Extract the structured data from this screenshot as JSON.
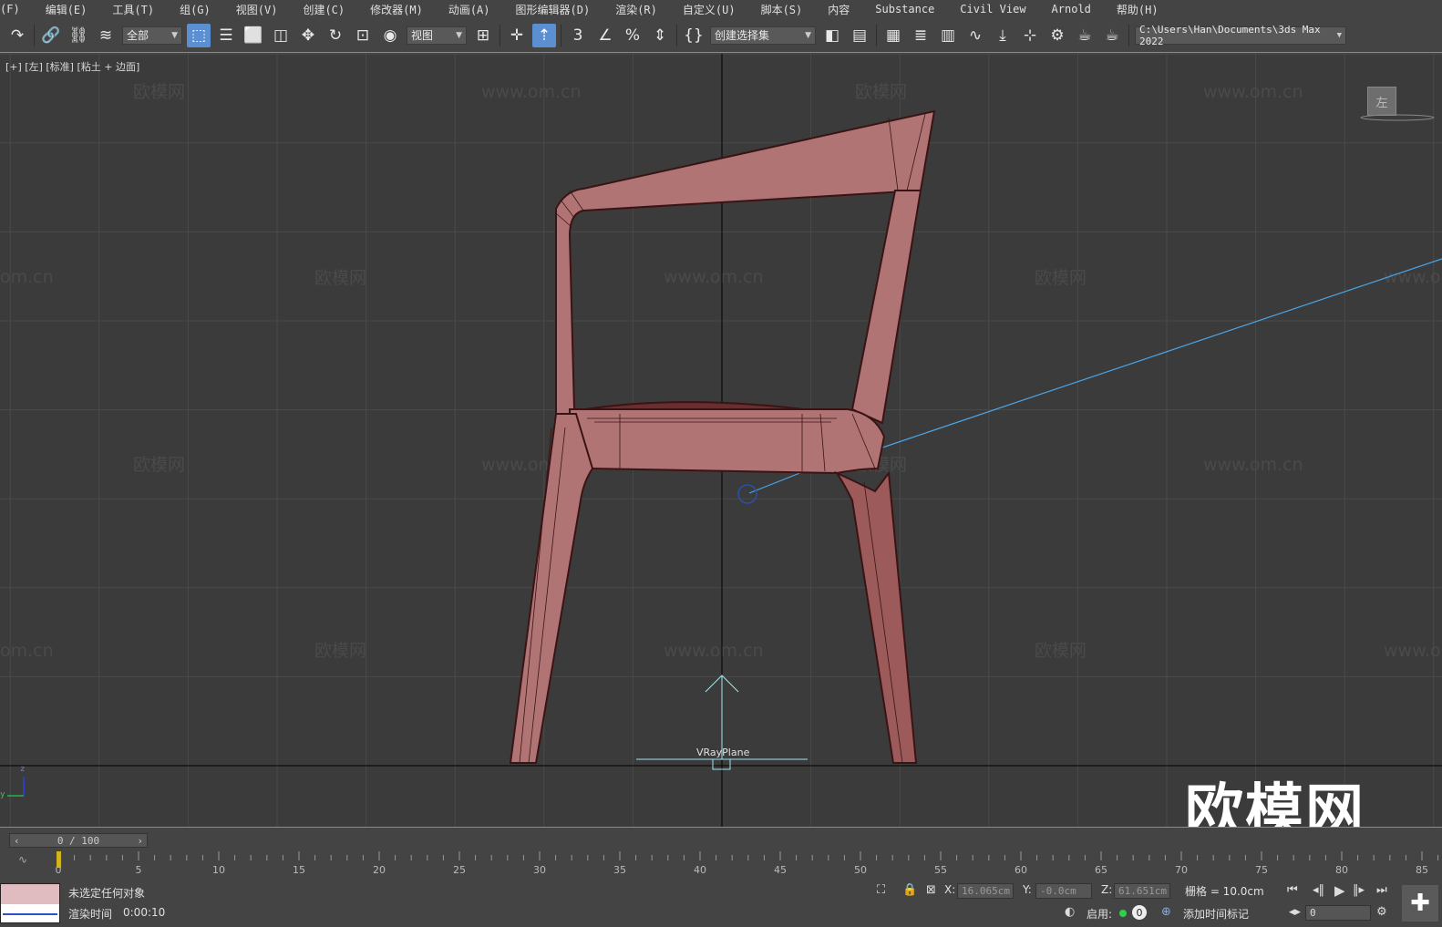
{
  "menu": [
    "(F)",
    "编辑(E)",
    "工具(T)",
    "组(G)",
    "视图(V)",
    "创建(C)",
    "修改器(M)",
    "动画(A)",
    "图形编辑器(D)",
    "渲染(R)",
    "自定义(U)",
    "脚本(S)",
    "内容",
    "Substance",
    "Civil View",
    "Arnold",
    "帮助(H)"
  ],
  "toolbar": {
    "selection_filter": "全部",
    "reference_coord": "视图",
    "named_selection": "创建选择集",
    "project_path": "C:\\Users\\Han\\Documents\\3ds Max 2022",
    "snap_label": "3"
  },
  "viewport": {
    "label": "[+] [左] [标准] [粘土 + 边面]",
    "object_label": "VRayPlane",
    "viewcube_face": "左",
    "watermark_big": "欧模网",
    "watermark_cn": "欧模网",
    "watermark_url": "www.om.cn",
    "watermark_partial": "om.cn",
    "watermark_partial2": "www.o",
    "axis_z": "z",
    "axis_y": "y"
  },
  "timeline": {
    "frame_display": "0 / 100",
    "ticks": [
      "0",
      "5",
      "10",
      "15",
      "20",
      "25",
      "30",
      "35",
      "40",
      "45",
      "50",
      "55",
      "60",
      "65",
      "70",
      "75",
      "80",
      "85"
    ]
  },
  "status": {
    "selection": "未选定任何对象",
    "render_time_label": "渲染时间",
    "render_time": "0:00:10",
    "x_label": "X:",
    "x_value": "16.065cm",
    "y_label": "Y:",
    "y_value": "-0.0cm",
    "z_label": "Z:",
    "z_value": "61.651cm",
    "grid": "栅格 = 10.0cm",
    "enable_label": "启用:",
    "enable_count": "0",
    "add_time_tag": "添加时间标记",
    "frame_value": "0"
  },
  "colors": {
    "chair": "#b07474",
    "chair_edge": "#3a1414",
    "light_line": "#4aa6e8",
    "grid": "#4a4a4a",
    "accent": "#b38b1a"
  }
}
